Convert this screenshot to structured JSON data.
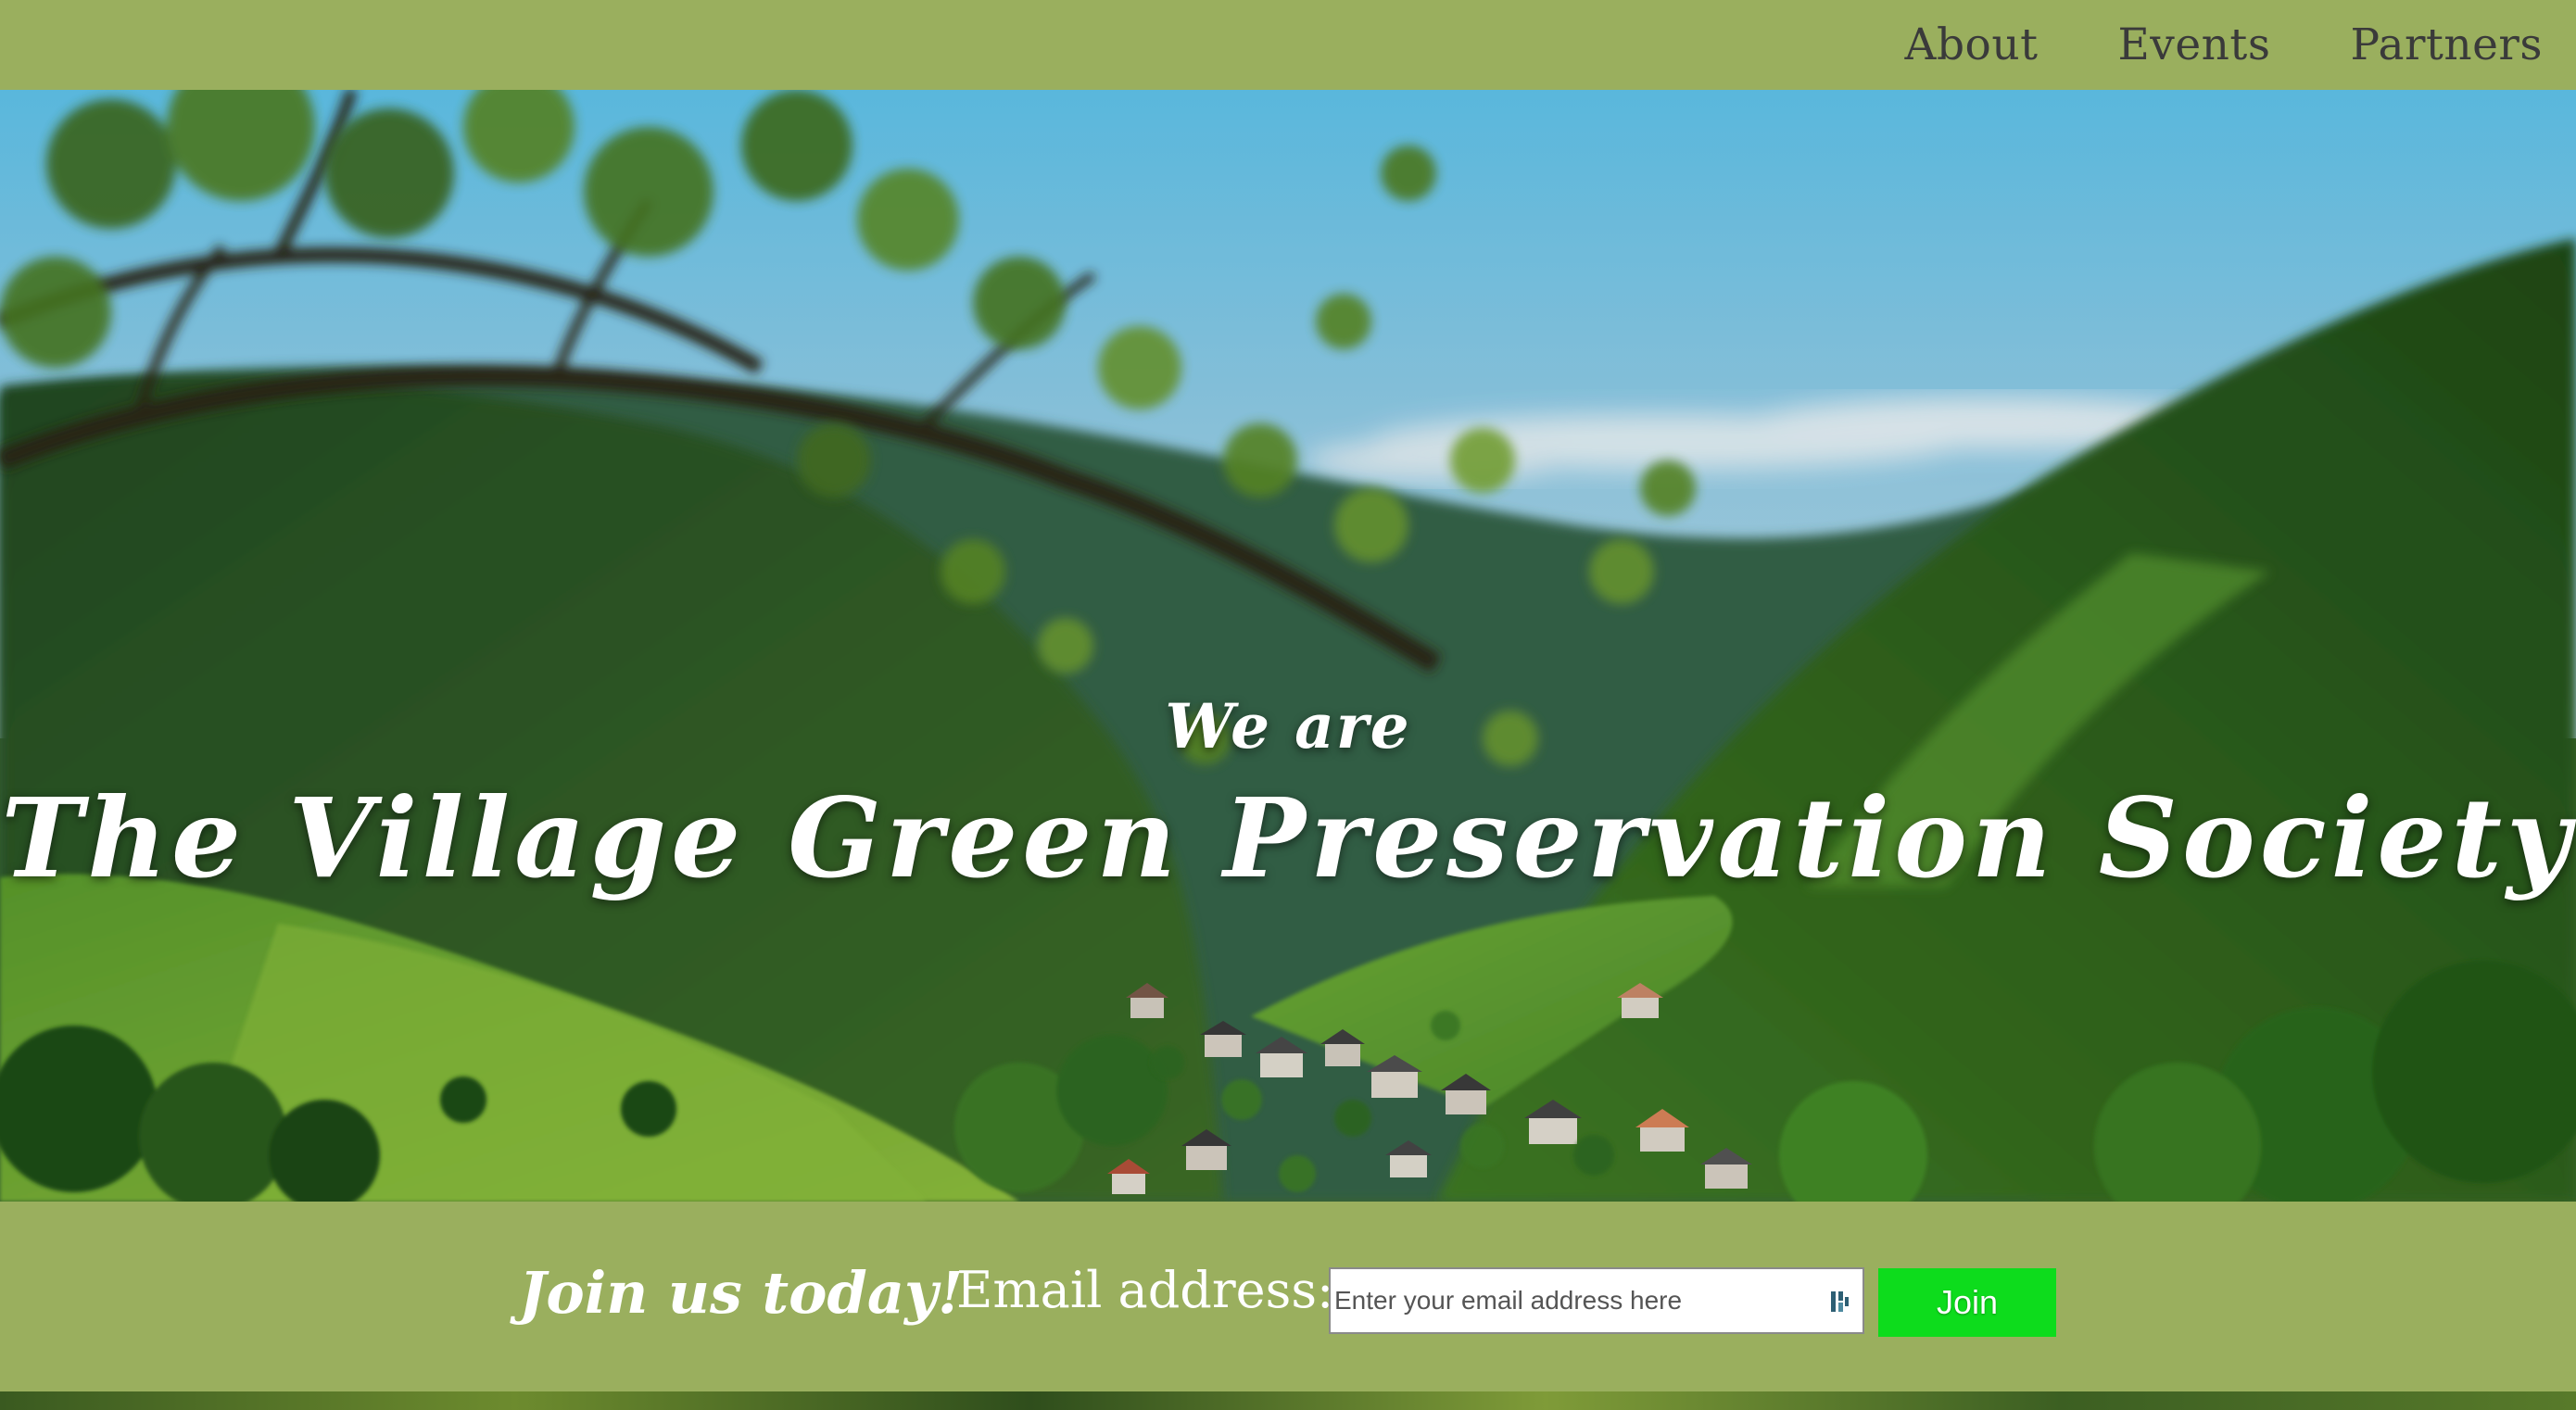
{
  "nav": {
    "items": [
      {
        "label": "About"
      },
      {
        "label": "Events"
      },
      {
        "label": "Partners"
      }
    ]
  },
  "hero": {
    "subtitle": "We are",
    "title": "The Village Green Preservation Society"
  },
  "join": {
    "heading": "Join us today!",
    "email_label": "Email address:",
    "email_placeholder": "Enter your email address here",
    "email_value": "",
    "button_label": "Join"
  },
  "colors": {
    "bar_background": "#9aaf5e",
    "join_button": "#0ddc1c",
    "nav_text": "#3a3a3a",
    "hero_text": "#ffffff"
  },
  "icons": [
    "password-manager-icon"
  ]
}
